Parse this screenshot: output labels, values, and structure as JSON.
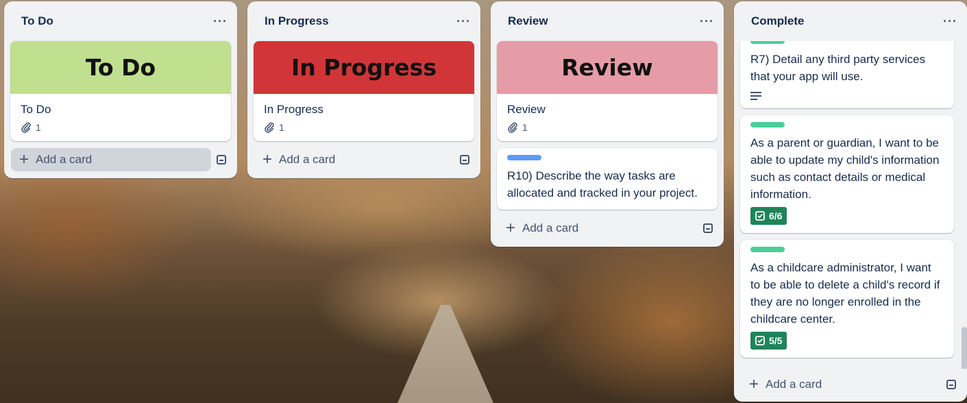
{
  "lists": [
    {
      "title": "To Do",
      "menu": "···",
      "add_label": "Add a card",
      "cover": {
        "text": "To Do",
        "color": "#c0df8f"
      },
      "card": {
        "title": "To Do",
        "attachments": "1"
      }
    },
    {
      "title": "In Progress",
      "menu": "···",
      "add_label": "Add a card",
      "cover": {
        "text": "In Progress",
        "color": "#d13537"
      },
      "card": {
        "title": "In Progress",
        "attachments": "1"
      }
    },
    {
      "title": "Review",
      "menu": "···",
      "add_label": "Add a card",
      "cover": {
        "text": "Review",
        "color": "#e59ca6"
      },
      "card": {
        "title": "Review",
        "attachments": "1"
      },
      "card2": {
        "title": "R10) Describe the way tasks are allocated and tracked in your project.",
        "label_color": "#579dff"
      }
    },
    {
      "title": "Complete",
      "menu": "···",
      "add_label": "Add a card",
      "label_color": "#4bce97",
      "cards": [
        {
          "title": "R7) Detail any third party services that your app will use."
        },
        {
          "title": "As a parent or guardian, I want to be able to update my child's information such as contact details or medical information.",
          "checklist": "6/6"
        },
        {
          "title": "As a childcare administrator, I want to be able to delete a child's record if they are no longer enrolled in the childcare center.",
          "checklist": "5/5"
        }
      ]
    }
  ],
  "icons": {
    "attachment": "paperclip-icon",
    "description": "description-icon",
    "checklist": "checkbox-icon",
    "add": "plus-icon",
    "template": "card-template-icon"
  }
}
